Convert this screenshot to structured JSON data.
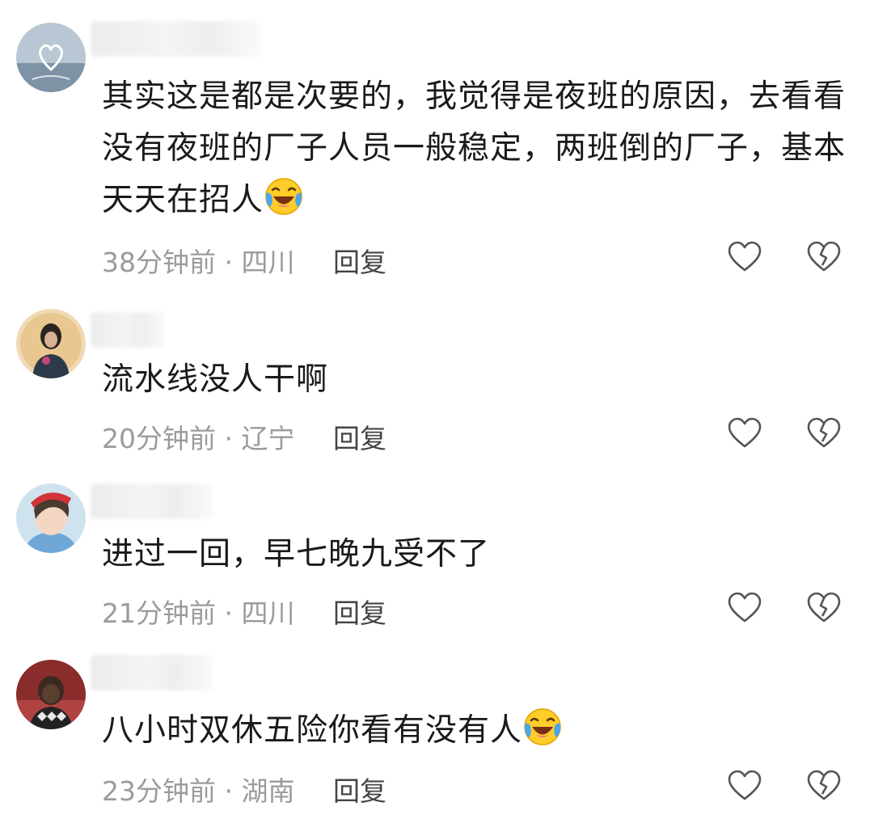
{
  "comments": [
    {
      "text": "其实这是都是次要的，我觉得是夜班的原因，去看看没有夜班的厂子人员一般稳定，两班倒的厂子，基本天天在招人",
      "emoji": "laughing-crying-emoji",
      "time": "38分钟前",
      "separator": "·",
      "location": "四川",
      "reply_label": "回复"
    },
    {
      "text": "流水线没人干啊",
      "time": "20分钟前",
      "separator": "·",
      "location": "辽宁",
      "reply_label": "回复"
    },
    {
      "text": "进过一回，早七晚九受不了",
      "time": "21分钟前",
      "separator": "·",
      "location": "四川",
      "reply_label": "回复"
    },
    {
      "text": "八小时双休五险你看有没有人",
      "emoji": "laughing-crying-emoji",
      "time": "23分钟前",
      "separator": "·",
      "location": "湖南",
      "reply_label": "回复"
    }
  ],
  "icons": {
    "like": "heart-outline-icon",
    "dislike": "broken-heart-icon"
  },
  "colors": {
    "text": "#1a1a1a",
    "meta": "#9b9b9b",
    "reply": "#444444",
    "icon": "#555555"
  }
}
